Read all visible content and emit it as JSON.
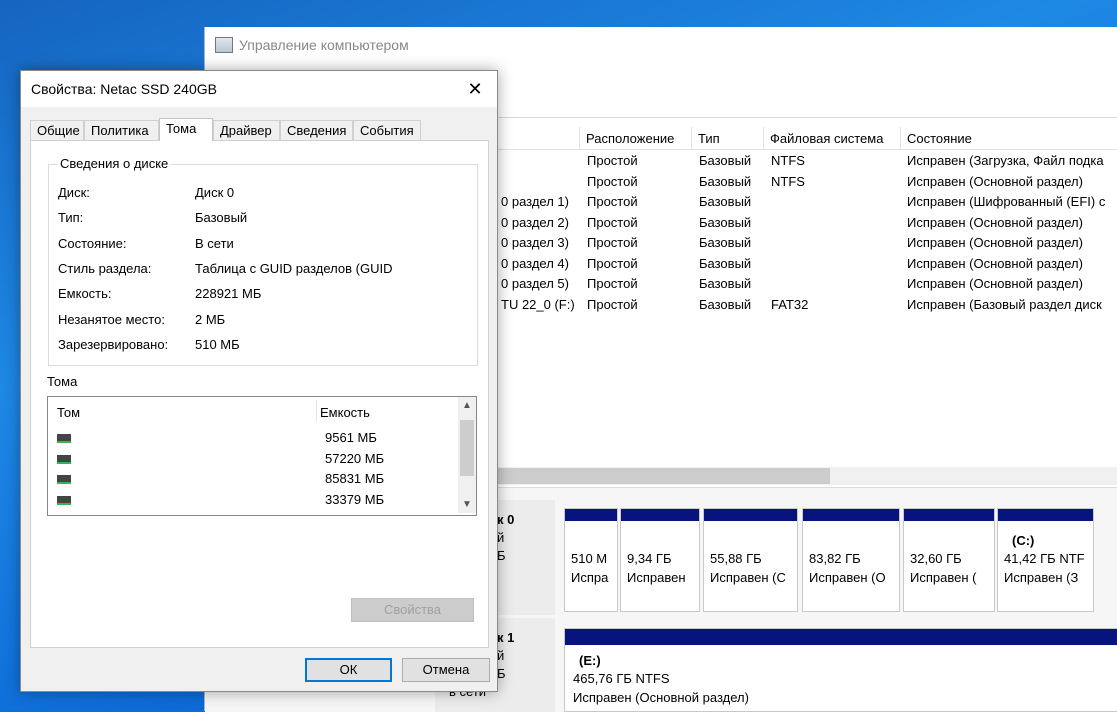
{
  "main_window": {
    "title": "Управление компьютером",
    "columns": [
      "Расположение",
      "Тип",
      "Файловая система",
      "Состояние"
    ],
    "rows": [
      {
        "vol": "",
        "layout": "Простой",
        "type": "Базовый",
        "fs": "NTFS",
        "status": "Исправен (Загрузка, Файл подка"
      },
      {
        "vol": "",
        "layout": "Простой",
        "type": "Базовый",
        "fs": "NTFS",
        "status": "Исправен (Основной раздел)"
      },
      {
        "vol": "0 раздел 1)",
        "layout": "Простой",
        "type": "Базовый",
        "fs": "",
        "status": "Исправен (Шифрованный (EFI) с"
      },
      {
        "vol": "0 раздел 2)",
        "layout": "Простой",
        "type": "Базовый",
        "fs": "",
        "status": "Исправен (Основной раздел)"
      },
      {
        "vol": "0 раздел 3)",
        "layout": "Простой",
        "type": "Базовый",
        "fs": "",
        "status": "Исправен (Основной раздел)"
      },
      {
        "vol": "0 раздел 4)",
        "layout": "Простой",
        "type": "Базовый",
        "fs": "",
        "status": "Исправен (Основной раздел)"
      },
      {
        "vol": "0 раздел 5)",
        "layout": "Простой",
        "type": "Базовый",
        "fs": "",
        "status": "Исправен (Основной раздел)"
      },
      {
        "vol": "TU 22_0 (F:)",
        "layout": "Простой",
        "type": "Базовый",
        "fs": "FAT32",
        "status": "Исправен (Базовый раздел диск"
      }
    ],
    "disk0": {
      "label": "к 0",
      "line2": "й",
      "line3": "Б",
      "partitions": [
        {
          "name": "",
          "size": "510 М",
          "status": "Испра"
        },
        {
          "name": "",
          "size": "9,34 ГБ",
          "status": "Исправен"
        },
        {
          "name": "",
          "size": "55,88 ГБ",
          "status": "Исправен (С"
        },
        {
          "name": "",
          "size": "83,82 ГБ",
          "status": "Исправен (О"
        },
        {
          "name": "",
          "size": "32,60 ГБ",
          "status": "Исправен ("
        },
        {
          "name": "(C:)",
          "size": "41,42 ГБ NTF",
          "status": "Исправен (З"
        }
      ]
    },
    "disk1": {
      "label": "к 1",
      "line2": "й",
      "line3": "Б",
      "line4": "в сети",
      "partition": {
        "name": "(E:)",
        "size": "465,76 ГБ NTFS",
        "status": "Исправен (Основной раздел)"
      }
    }
  },
  "dialog": {
    "title": "Свойства: Netac SSD 240GB",
    "close_glyph": "✕",
    "tabs": [
      "Общие",
      "Политика",
      "Тома",
      "Драйвер",
      "Сведения",
      "События"
    ],
    "active_tab": "Тома",
    "disk_info": {
      "legend": "Сведения о диске",
      "props": [
        {
          "label": "Диск:",
          "value": "Диск 0"
        },
        {
          "label": "Тип:",
          "value": "Базовый"
        },
        {
          "label": "Состояние:",
          "value": "В сети"
        },
        {
          "label": "Стиль раздела:",
          "value": "Таблица с GUID разделов (GUID"
        },
        {
          "label": "Емкость:",
          "value": "228921 МБ"
        },
        {
          "label": "Незанятое место:",
          "value": "2 МБ"
        },
        {
          "label": "Зарезервировано:",
          "value": "510 МБ"
        }
      ]
    },
    "volumes": {
      "label": "Тома",
      "col_volume": "Том",
      "col_capacity": "Емкость",
      "items": [
        {
          "name": "",
          "capacity": "9561 МБ"
        },
        {
          "name": "",
          "capacity": "57220 МБ"
        },
        {
          "name": "",
          "capacity": "85831 МБ"
        },
        {
          "name": "",
          "capacity": "33379 МБ"
        }
      ]
    },
    "properties_button": "Свойства",
    "ok_button": "ОК",
    "cancel_button": "Отмена"
  }
}
